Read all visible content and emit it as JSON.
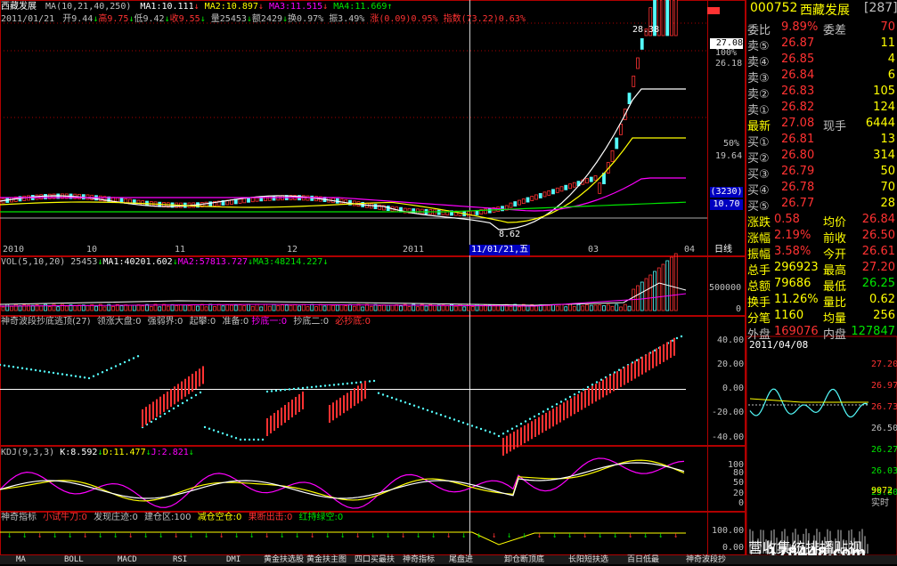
{
  "stock": {
    "code": "000752",
    "name": "西藏发展",
    "num": "[287]"
  },
  "main_chart": {
    "header1": {
      "name": "西藏发展",
      "ma_def": "MA(10,21,40,250)",
      "ma1": "MA1:10.111",
      "ma2": "MA2:10.897",
      "ma3": "MA3:11.515",
      "ma4": "MA4:11.669"
    },
    "header2": {
      "date": "2011/01/21",
      "open": "开9.44",
      "high": "高9.75",
      "low": "低9.42",
      "close": "收9.55",
      "vol": "量25453",
      "amt": "额2429",
      "turn": "换0.97%",
      "amp": "振3.49%",
      "chg": "涨(0.09)0.95%",
      "idx": "指数(73.22)0.63%"
    },
    "price_labels": [
      "28.38",
      "8.62"
    ],
    "y_labels": [
      "27.08",
      "100%",
      "26.18",
      "50%",
      "19.64",
      "(3230)",
      "10.70"
    ],
    "x_labels": [
      "2010",
      "10",
      "11",
      "12",
      "2011",
      "11/01/21,五",
      "03",
      "04",
      "日线"
    ]
  },
  "vol_panel": {
    "header": "VOL(5,10,20) 25453",
    "ma1": "MA1:40201.602",
    "ma2": "MA2:57813.727",
    "ma3": "MA3:48214.227",
    "y_labels": [
      "500000",
      "0"
    ]
  },
  "swing_panel": {
    "header": "神奇波段抄底逃顶(27)",
    "items": [
      "领涨大盘:0",
      "强弱界:0",
      "起攀:0",
      "准备:0"
    ],
    "item_b1": "抄底一:0",
    "item_b2": "抄底二:0",
    "item_b3": "必抄底:0",
    "y_labels": [
      "40.00",
      "20.00",
      "0.00",
      "-20.00",
      "-40.00"
    ]
  },
  "kdj_panel": {
    "header": "KDJ(9,3,3)",
    "k": "K:8.592",
    "d": "D:11.477",
    "j": "J:2.821",
    "y_labels": [
      "100",
      "80",
      "50",
      "20",
      "0"
    ]
  },
  "god_panel": {
    "header": "神奇指标",
    "i1": "小试牛刀:0",
    "i2": "发现庄迹:0",
    "i3": "建仓区:100",
    "i4": "减仓空仓:0",
    "i5": "果断出击:0",
    "i6": "红持绿空:0",
    "y_labels": [
      "100.00",
      "0.00"
    ]
  },
  "quote": {
    "weibi": {
      "label": "委比",
      "value": "9.89%",
      "label2": "委差",
      "value2": "70"
    },
    "sells": [
      {
        "label": "卖⑤",
        "price": "26.87",
        "vol": "11"
      },
      {
        "label": "卖④",
        "price": "26.85",
        "vol": "4"
      },
      {
        "label": "卖③",
        "price": "26.84",
        "vol": "6"
      },
      {
        "label": "卖②",
        "price": "26.83",
        "vol": "105"
      },
      {
        "label": "卖①",
        "price": "26.82",
        "vol": "124"
      }
    ],
    "latest": {
      "label": "最新",
      "price": "27.08",
      "label2": "现手",
      "vol": "6444"
    },
    "buys": [
      {
        "label": "买①",
        "price": "26.81",
        "vol": "13"
      },
      {
        "label": "买②",
        "price": "26.80",
        "vol": "314"
      },
      {
        "label": "买③",
        "price": "26.79",
        "vol": "50"
      },
      {
        "label": "买④",
        "price": "26.78",
        "vol": "70"
      },
      {
        "label": "买⑤",
        "price": "26.77",
        "vol": "28"
      }
    ],
    "stats": [
      {
        "l1": "涨跌",
        "v1": "0.58",
        "l2": "均价",
        "v2": "26.84"
      },
      {
        "l1": "涨幅",
        "v1": "2.19%",
        "l2": "前收",
        "v2": "26.50"
      },
      {
        "l1": "振幅",
        "v1": "3.58%",
        "l2": "今开",
        "v2": "26.61"
      },
      {
        "l1": "总手",
        "v1": "296923",
        "l2": "最高",
        "v2": "27.20"
      },
      {
        "l1": "总额",
        "v1": "79686",
        "l2": "最低",
        "v2": "26.25"
      },
      {
        "l1": "换手",
        "v1": "11.26%",
        "l2": "量比",
        "v2": "0.62"
      },
      {
        "l1": "分笔",
        "v1": "1160",
        "l2": "均量",
        "v2": "256"
      }
    ],
    "outer": {
      "l1": "外盘",
      "v1": "169076",
      "l2": "内盘",
      "v2": "127847"
    }
  },
  "minichart": {
    "date": "2011/04/08",
    "y_labels": [
      "27.20",
      "26.97",
      "26.73",
      "26.50",
      "26.27",
      "26.03",
      "25.80"
    ],
    "vol_label": "9072",
    "mode": "实时"
  },
  "tabs": [
    "MA",
    "BOLL",
    "MACD",
    "RSI",
    "DMI",
    "黄金扶选股",
    "黄金扶主图",
    "四口买最扶",
    "神奇指标",
    "尾盘进",
    "卸仓断顶底",
    "长阳短扶选",
    "百日低最",
    "神奇波段抄"
  ],
  "bottom_marquee": "营收集统排播贴视",
  "watermark": "178448.com",
  "colors": {
    "up": "#ff3232",
    "down": "#54fcfc",
    "ma1": "#ffffff",
    "ma2": "#ffff00",
    "ma3": "#ff00ff",
    "ma4": "#00e600",
    "frame": "#b00000"
  }
}
